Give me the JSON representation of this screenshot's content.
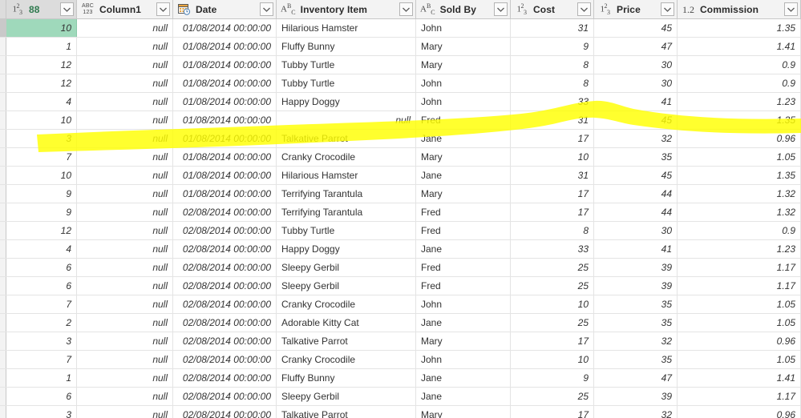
{
  "app": {
    "type": "data-grid",
    "colors": {
      "selection": "#9fd9bb",
      "highlighter": "#ffff00",
      "header_bg": "#f3f3f3",
      "grid_line": "#e4e4e4"
    }
  },
  "columns": [
    {
      "label": "88",
      "type_icon": "number-type-icon",
      "type_glyph": "1²3",
      "align": "right",
      "selected": true,
      "header_highlight": true
    },
    {
      "label": "Column1",
      "type_icon": "any-type-icon",
      "type_glyph": "ABC123",
      "align": "right",
      "selected": false,
      "header_highlight": false
    },
    {
      "label": "Date",
      "type_icon": "date-time-type-icon",
      "type_glyph": "calendar",
      "align": "left",
      "selected": false,
      "header_highlight": false
    },
    {
      "label": "Inventory Item",
      "type_icon": "text-type-icon",
      "type_glyph": "ABC",
      "align": "left",
      "selected": false,
      "header_highlight": false
    },
    {
      "label": "Sold By",
      "type_icon": "text-type-icon",
      "type_glyph": "ABC",
      "align": "left",
      "selected": false,
      "header_highlight": false
    },
    {
      "label": "Cost",
      "type_icon": "number-type-icon",
      "type_glyph": "1²3",
      "align": "right",
      "selected": false,
      "header_highlight": false
    },
    {
      "label": "Price",
      "type_icon": "number-type-icon",
      "type_glyph": "1²3",
      "align": "right",
      "selected": false,
      "header_highlight": false
    },
    {
      "label": "Commission",
      "type_icon": "decimal-type-icon",
      "type_glyph": "1.2",
      "align": "right",
      "selected": false,
      "header_highlight": false
    }
  ],
  "filter_button_label": "Filter dropdown",
  "rows": [
    {
      "col0": "10",
      "col1": "null",
      "date": "01/08/2014 00:00:00",
      "item": "Hilarious Hamster",
      "sold_by": "John",
      "cost": "31",
      "price": "45",
      "commission": "1.35",
      "item_is_null": false,
      "selected": true,
      "highlighted": false
    },
    {
      "col0": "1",
      "col1": "null",
      "date": "01/08/2014 00:00:00",
      "item": "Fluffy Bunny",
      "sold_by": "Mary",
      "cost": "9",
      "price": "47",
      "commission": "1.41",
      "item_is_null": false,
      "selected": false,
      "highlighted": false
    },
    {
      "col0": "12",
      "col1": "null",
      "date": "01/08/2014 00:00:00",
      "item": "Tubby Turtle",
      "sold_by": "Mary",
      "cost": "8",
      "price": "30",
      "commission": "0.9",
      "item_is_null": false,
      "selected": false,
      "highlighted": false
    },
    {
      "col0": "12",
      "col1": "null",
      "date": "01/08/2014 00:00:00",
      "item": "Tubby Turtle",
      "sold_by": "John",
      "cost": "8",
      "price": "30",
      "commission": "0.9",
      "item_is_null": false,
      "selected": false,
      "highlighted": false
    },
    {
      "col0": "4",
      "col1": "null",
      "date": "01/08/2014 00:00:00",
      "item": "Happy Doggy",
      "sold_by": "John",
      "cost": "33",
      "price": "41",
      "commission": "1.23",
      "item_is_null": false,
      "selected": false,
      "highlighted": false
    },
    {
      "col0": "10",
      "col1": "null",
      "date": "01/08/2014 00:00:00",
      "item": "null",
      "sold_by": "Fred",
      "cost": "31",
      "price": "45",
      "commission": "1.35",
      "item_is_null": true,
      "selected": false,
      "highlighted": true
    },
    {
      "col0": "3",
      "col1": "null",
      "date": "01/08/2014 00:00:00",
      "item": "Talkative Parrot",
      "sold_by": "Jane",
      "cost": "17",
      "price": "32",
      "commission": "0.96",
      "item_is_null": false,
      "selected": false,
      "highlighted": false
    },
    {
      "col0": "7",
      "col1": "null",
      "date": "01/08/2014 00:00:00",
      "item": "Cranky Crocodile",
      "sold_by": "Mary",
      "cost": "10",
      "price": "35",
      "commission": "1.05",
      "item_is_null": false,
      "selected": false,
      "highlighted": false
    },
    {
      "col0": "10",
      "col1": "null",
      "date": "01/08/2014 00:00:00",
      "item": "Hilarious Hamster",
      "sold_by": "Jane",
      "cost": "31",
      "price": "45",
      "commission": "1.35",
      "item_is_null": false,
      "selected": false,
      "highlighted": false
    },
    {
      "col0": "9",
      "col1": "null",
      "date": "01/08/2014 00:00:00",
      "item": "Terrifying Tarantula",
      "sold_by": "Mary",
      "cost": "17",
      "price": "44",
      "commission": "1.32",
      "item_is_null": false,
      "selected": false,
      "highlighted": false
    },
    {
      "col0": "9",
      "col1": "null",
      "date": "02/08/2014 00:00:00",
      "item": "Terrifying Tarantula",
      "sold_by": "Fred",
      "cost": "17",
      "price": "44",
      "commission": "1.32",
      "item_is_null": false,
      "selected": false,
      "highlighted": false
    },
    {
      "col0": "12",
      "col1": "null",
      "date": "02/08/2014 00:00:00",
      "item": "Tubby Turtle",
      "sold_by": "Fred",
      "cost": "8",
      "price": "30",
      "commission": "0.9",
      "item_is_null": false,
      "selected": false,
      "highlighted": false
    },
    {
      "col0": "4",
      "col1": "null",
      "date": "02/08/2014 00:00:00",
      "item": "Happy Doggy",
      "sold_by": "Jane",
      "cost": "33",
      "price": "41",
      "commission": "1.23",
      "item_is_null": false,
      "selected": false,
      "highlighted": false
    },
    {
      "col0": "6",
      "col1": "null",
      "date": "02/08/2014 00:00:00",
      "item": "Sleepy Gerbil",
      "sold_by": "Fred",
      "cost": "25",
      "price": "39",
      "commission": "1.17",
      "item_is_null": false,
      "selected": false,
      "highlighted": false
    },
    {
      "col0": "6",
      "col1": "null",
      "date": "02/08/2014 00:00:00",
      "item": "Sleepy Gerbil",
      "sold_by": "Fred",
      "cost": "25",
      "price": "39",
      "commission": "1.17",
      "item_is_null": false,
      "selected": false,
      "highlighted": false
    },
    {
      "col0": "7",
      "col1": "null",
      "date": "02/08/2014 00:00:00",
      "item": "Cranky Crocodile",
      "sold_by": "John",
      "cost": "10",
      "price": "35",
      "commission": "1.05",
      "item_is_null": false,
      "selected": false,
      "highlighted": false
    },
    {
      "col0": "2",
      "col1": "null",
      "date": "02/08/2014 00:00:00",
      "item": "Adorable Kitty Cat",
      "sold_by": "Jane",
      "cost": "25",
      "price": "35",
      "commission": "1.05",
      "item_is_null": false,
      "selected": false,
      "highlighted": false
    },
    {
      "col0": "3",
      "col1": "null",
      "date": "02/08/2014 00:00:00",
      "item": "Talkative Parrot",
      "sold_by": "Mary",
      "cost": "17",
      "price": "32",
      "commission": "0.96",
      "item_is_null": false,
      "selected": false,
      "highlighted": false
    },
    {
      "col0": "7",
      "col1": "null",
      "date": "02/08/2014 00:00:00",
      "item": "Cranky Crocodile",
      "sold_by": "John",
      "cost": "10",
      "price": "35",
      "commission": "1.05",
      "item_is_null": false,
      "selected": false,
      "highlighted": false
    },
    {
      "col0": "1",
      "col1": "null",
      "date": "02/08/2014 00:00:00",
      "item": "Fluffy Bunny",
      "sold_by": "Jane",
      "cost": "9",
      "price": "47",
      "commission": "1.41",
      "item_is_null": false,
      "selected": false,
      "highlighted": false
    },
    {
      "col0": "6",
      "col1": "null",
      "date": "02/08/2014 00:00:00",
      "item": "Sleepy Gerbil",
      "sold_by": "Jane",
      "cost": "25",
      "price": "39",
      "commission": "1.17",
      "item_is_null": false,
      "selected": false,
      "highlighted": false
    },
    {
      "col0": "3",
      "col1": "null",
      "date": "02/08/2014 00:00:00",
      "item": "Talkative Parrot",
      "sold_by": "Mary",
      "cost": "17",
      "price": "32",
      "commission": "0.96",
      "item_is_null": false,
      "selected": false,
      "highlighted": false
    }
  ]
}
